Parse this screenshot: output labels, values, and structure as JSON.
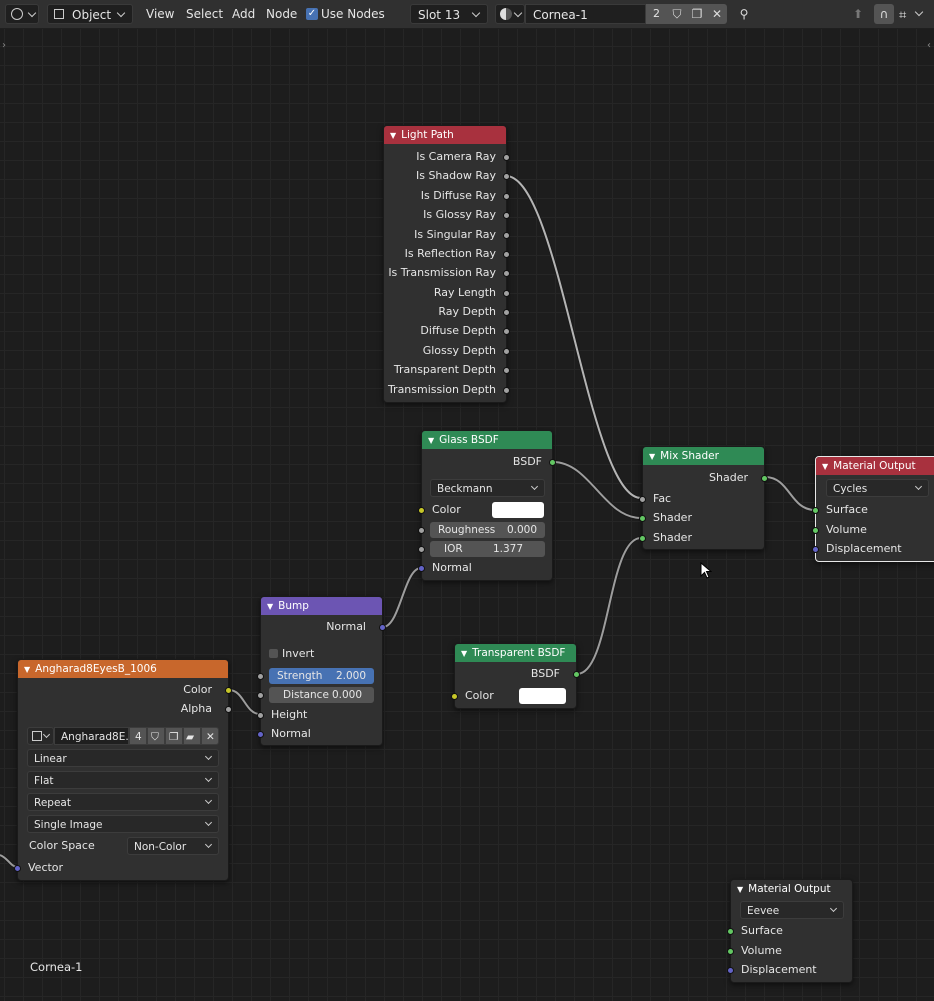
{
  "header": {
    "mode": "Object",
    "menus": [
      "View",
      "Select",
      "Add",
      "Node"
    ],
    "use_nodes_label": "Use Nodes",
    "use_nodes_checked": true,
    "slot": "Slot 13",
    "material_name": "Cornea-1",
    "user_count": "2"
  },
  "nodes": {
    "light_path": {
      "title": "Light Path",
      "header_color": "#a8313e",
      "outputs": [
        "Is Camera Ray",
        "Is Shadow Ray",
        "Is Diffuse Ray",
        "Is Glossy Ray",
        "Is Singular Ray",
        "Is Reflection Ray",
        "Is Transmission Ray",
        "Ray Length",
        "Ray Depth",
        "Diffuse Depth",
        "Glossy Depth",
        "Transparent Depth",
        "Transmission Depth"
      ]
    },
    "glass_bsdf": {
      "title": "Glass BSDF",
      "header_color": "#2f8a55",
      "output": "BSDF",
      "distribution": "Beckmann",
      "color_label": "Color",
      "roughness_label": "Roughness",
      "roughness_value": "0.000",
      "ior_label": "IOR",
      "ior_value": "1.377",
      "normal_label": "Normal"
    },
    "mix_shader": {
      "title": "Mix Shader",
      "header_color": "#2f8a55",
      "output": "Shader",
      "inputs": [
        "Fac",
        "Shader",
        "Shader"
      ]
    },
    "material_output_cycles": {
      "title": "Material Output",
      "header_color": "#a8313e",
      "target": "Cycles",
      "inputs": [
        "Surface",
        "Volume",
        "Displacement"
      ]
    },
    "bump": {
      "title": "Bump",
      "header_color": "#6c55b3",
      "output": "Normal",
      "invert_label": "Invert",
      "strength_label": "Strength",
      "strength_value": "2.000",
      "distance_label": "Distance",
      "distance_value": "0.000",
      "height_label": "Height",
      "normal_label": "Normal"
    },
    "transparent_bsdf": {
      "title": "Transparent BSDF",
      "header_color": "#2f8a55",
      "output": "BSDF",
      "color_label": "Color"
    },
    "image_texture": {
      "title": "Angharad8EyesB_1006",
      "header_color": "#c8672c",
      "outputs": [
        "Color",
        "Alpha"
      ],
      "image_name": "Angharad8E...",
      "image_users": "4",
      "interpolation": "Linear",
      "projection": "Flat",
      "extension": "Repeat",
      "source": "Single Image",
      "color_space_label": "Color Space",
      "color_space": "Non-Color",
      "vector_label": "Vector"
    },
    "material_output_eevee": {
      "title": "Material Output",
      "header_color": "#303030",
      "target": "Eevee",
      "inputs": [
        "Surface",
        "Volume",
        "Displacement"
      ]
    }
  },
  "footer_label": "Cornea-1"
}
